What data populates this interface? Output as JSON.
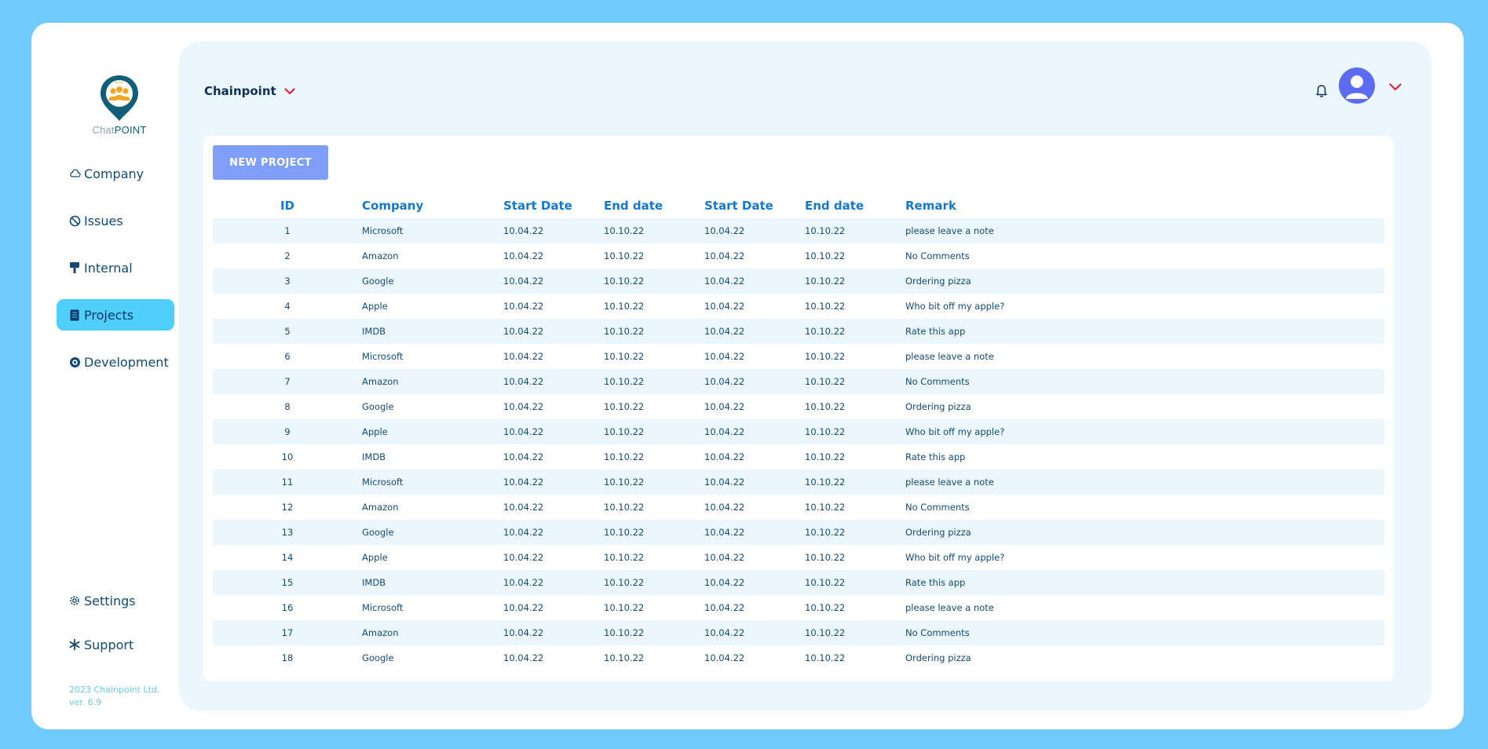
{
  "sidebar": {
    "logo": {
      "text_light": "Chat",
      "text_bold": "POINT",
      "icon": "chat-point-logo"
    },
    "items": [
      {
        "label": "Company",
        "icon": "cloud-icon",
        "active": false
      },
      {
        "label": "Issues",
        "icon": "no-entry-icon",
        "active": false
      },
      {
        "label": "Internal",
        "icon": "paint-roller-icon",
        "active": false
      },
      {
        "label": "Projects",
        "icon": "document-icon",
        "active": true
      },
      {
        "label": "Development",
        "icon": "target-icon",
        "active": false
      }
    ],
    "bottom_items": [
      {
        "label": "Settings",
        "icon": "gear-icon"
      },
      {
        "label": "Support",
        "icon": "snowflake-icon"
      }
    ],
    "footer": "2023 Chainpoint Ltd. ver. 6.9"
  },
  "header": {
    "workspace": "Chainpoint",
    "icons": [
      "bell-icon",
      "user-avatar-icon",
      "chevron-down-icon"
    ]
  },
  "colors": {
    "background": "#6fcbfb",
    "panel": "#ecf7fd",
    "accent_red": "#e5203a",
    "active_nav": "#4fd0fb",
    "button": "#7f9ef7",
    "header_text": "#1678c9"
  },
  "toolbar": {
    "new_project_label": "NEW PROJECT"
  },
  "table": {
    "columns": [
      "ID",
      "Company",
      "Start Date",
      "End date",
      "Start Date",
      "End date",
      "Remark"
    ],
    "rows": [
      [
        "1",
        "Microsoft",
        "10.04.22",
        "10.10.22",
        "10.04.22",
        "10.10.22",
        "please leave a note"
      ],
      [
        "2",
        "Amazon",
        "10.04.22",
        "10.10.22",
        "10.04.22",
        "10.10.22",
        "No Comments"
      ],
      [
        "3",
        "Google",
        "10.04.22",
        "10.10.22",
        "10.04.22",
        "10.10.22",
        "Ordering pizza"
      ],
      [
        "4",
        "Apple",
        "10.04.22",
        "10.10.22",
        "10.04.22",
        "10.10.22",
        "Who bit off my apple?"
      ],
      [
        "5",
        "IMDB",
        "10.04.22",
        "10.10.22",
        "10.04.22",
        "10.10.22",
        "Rate this app"
      ],
      [
        "6",
        "Microsoft",
        "10.04.22",
        "10.10.22",
        "10.04.22",
        "10.10.22",
        "please leave a note"
      ],
      [
        "7",
        "Amazon",
        "10.04.22",
        "10.10.22",
        "10.04.22",
        "10.10.22",
        "No Comments"
      ],
      [
        "8",
        "Google",
        "10.04.22",
        "10.10.22",
        "10.04.22",
        "10.10.22",
        "Ordering pizza"
      ],
      [
        "9",
        "Apple",
        "10.04.22",
        "10.10.22",
        "10.04.22",
        "10.10.22",
        "Who bit off my apple?"
      ],
      [
        "10",
        "IMDB",
        "10.04.22",
        "10.10.22",
        "10.04.22",
        "10.10.22",
        "Rate this app"
      ],
      [
        "11",
        "Microsoft",
        "10.04.22",
        "10.10.22",
        "10.04.22",
        "10.10.22",
        "please leave a note"
      ],
      [
        "12",
        "Amazon",
        "10.04.22",
        "10.10.22",
        "10.04.22",
        "10.10.22",
        "No Comments"
      ],
      [
        "13",
        "Google",
        "10.04.22",
        "10.10.22",
        "10.04.22",
        "10.10.22",
        "Ordering pizza"
      ],
      [
        "14",
        "Apple",
        "10.04.22",
        "10.10.22",
        "10.04.22",
        "10.10.22",
        "Who bit off my apple?"
      ],
      [
        "15",
        "IMDB",
        "10.04.22",
        "10.10.22",
        "10.04.22",
        "10.10.22",
        "Rate this app"
      ],
      [
        "16",
        "Microsoft",
        "10.04.22",
        "10.10.22",
        "10.04.22",
        "10.10.22",
        "please leave a note"
      ],
      [
        "17",
        "Amazon",
        "10.04.22",
        "10.10.22",
        "10.04.22",
        "10.10.22",
        "No Comments"
      ],
      [
        "18",
        "Google",
        "10.04.22",
        "10.10.22",
        "10.04.22",
        "10.10.22",
        "Ordering pizza"
      ]
    ]
  }
}
